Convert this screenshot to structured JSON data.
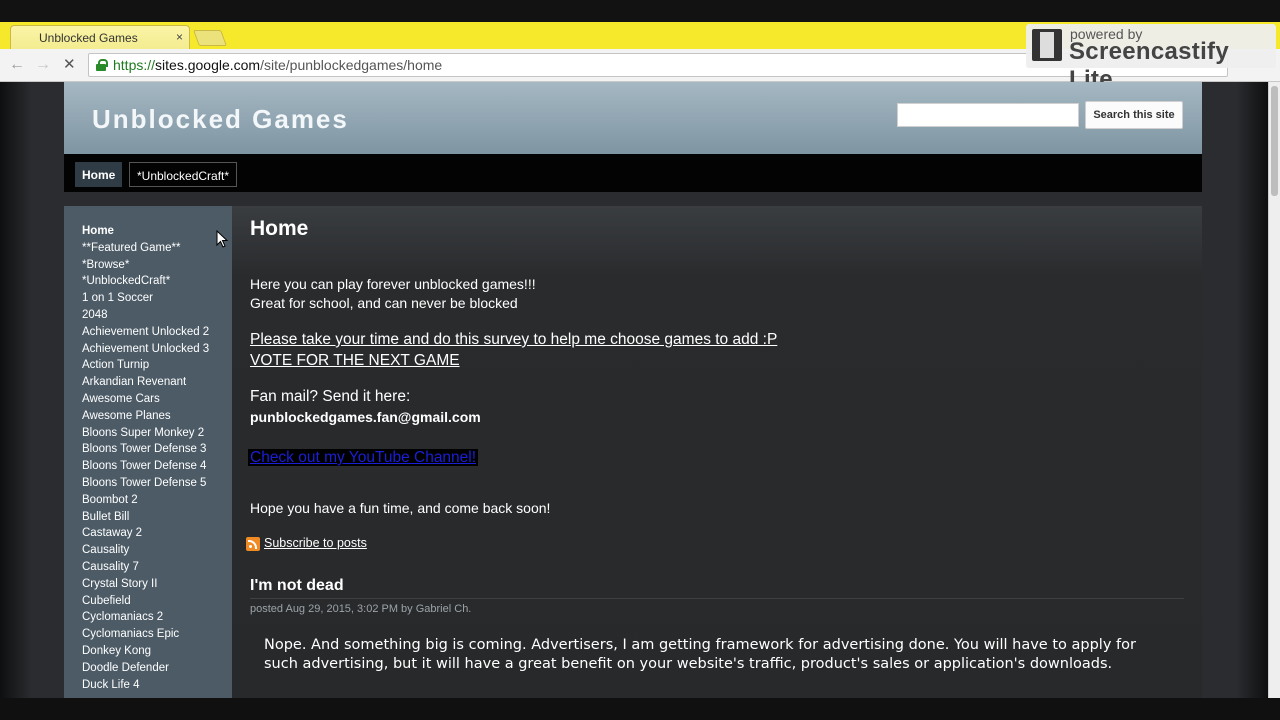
{
  "browser": {
    "tab_title": "Unblocked Games",
    "tab_close": "×",
    "back": "←",
    "forward": "→",
    "stop": "✕",
    "url_scheme": "https://",
    "url_host": "sites.google.com",
    "url_path": "/site/punblockedgames/home"
  },
  "watermark": {
    "small": "powered by",
    "big": "Screencastify Lite"
  },
  "site": {
    "title": "Unblocked Games",
    "search_button": "Search this site",
    "search_value": "",
    "nav": [
      "Home",
      "*UnblockedCraft*"
    ]
  },
  "sidebar": {
    "items": [
      "Home",
      "**Featured Game**",
      "*Browse*",
      "*UnblockedCraft*",
      "1 on 1 Soccer",
      "2048",
      "Achievement Unlocked 2",
      "Achievement Unlocked 3",
      "Action Turnip",
      "Arkandian Revenant",
      "Awesome Cars",
      "Awesome Planes",
      "Bloons Super Monkey 2",
      "Bloons Tower Defense 3",
      "Bloons Tower Defense 4",
      "Bloons Tower Defense 5",
      "Boombot 2",
      "Bullet Bill",
      "Castaway 2",
      "Causality",
      "Causality 7",
      "Crystal Story II",
      "Cubefield",
      "Cyclomaniacs 2",
      "Cyclomaniacs Epic",
      "Donkey Kong",
      "Doodle Defender",
      "Duck Life 4"
    ]
  },
  "content": {
    "title": "Home",
    "intro1": "Here you can play forever unblocked games!!!",
    "intro2": "Great for school, and can never be blocked",
    "survey_link": "Please take your time and do this survey to help me choose games to add :P",
    "vote_link": "VOTE FOR THE NEXT GAME",
    "fanmail": "Fan mail? Send it here:",
    "email": "punblockedgames.fan@gmail.com",
    "youtube_link": "Check out my YouTube Channel!",
    "closing": "Hope you have a fun time, and come back soon!",
    "subscribe": "Subscribe to posts"
  },
  "post": {
    "title": "I'm not dead",
    "meta": "posted Aug 29, 2015, 3:02 PM by Gabriel Ch.",
    "body": "Nope. And something big is coming. Advertisers, I am getting framework for advertising done. You will have to apply for such advertising, but it will have a great benefit on your website's traffic, product's sales or application's downloads."
  },
  "colors": {
    "tab_strip": "#f6e82a",
    "header": "#8fa5b1",
    "sidebar": "#4c5b66",
    "link_youtube": "#1b1fd6"
  }
}
